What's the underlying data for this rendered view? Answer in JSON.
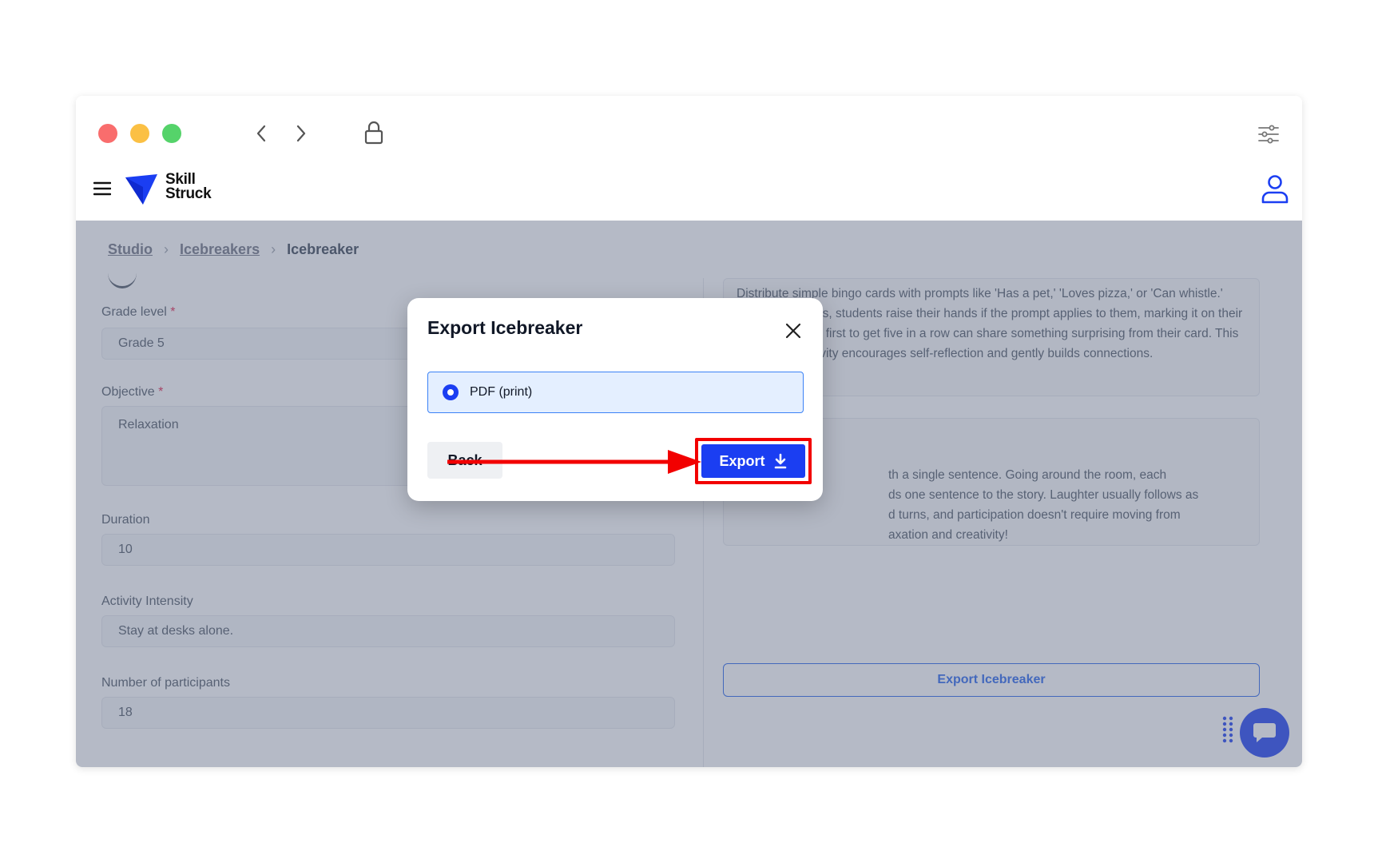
{
  "breadcrumb": {
    "items": [
      "Studio",
      "Icebreakers"
    ],
    "current": "Icebreaker",
    "separator": ">"
  },
  "brand": {
    "name_line1": "Skill",
    "name_line2": "Struck",
    "color": "#1b3ef2"
  },
  "form": {
    "grade_level": {
      "label": "Grade level",
      "required": "*",
      "value": "Grade 5"
    },
    "objective": {
      "label": "Objective",
      "required": "*",
      "value": "Relaxation"
    },
    "duration": {
      "label": "Duration",
      "value": "10"
    },
    "activity_intensity": {
      "label": "Activity Intensity",
      "value": "Stay at desks alone."
    },
    "participants": {
      "label": "Number of participants",
      "value": "18"
    }
  },
  "cards": {
    "first": "Distribute simple bingo cards with prompts like 'Has a pet,' 'Loves pizza,' or 'Can whistle.' From their desks, students raise their hands if the prompt applies to them, marking it on their bingo card. The first to get five in a row can share something surprising from their card. This low-energy activity encourages self-reflection and gently builds connections.",
    "second_line1": "th a single sentence. Going around the room, each",
    "second_line2": "ds one sentence to the story. Laughter usually follows as",
    "second_line3": "d turns, and participation doesn't require moving from",
    "second_line4": "axation and creativity!"
  },
  "export_outline_label": "Export Icebreaker",
  "modal": {
    "title": "Export Icebreaker",
    "option_label": "PDF (print)",
    "back_label": "Back",
    "export_label": "Export"
  },
  "colors": {
    "accent": "#1b3ef2",
    "highlight": "#f20000",
    "mac_red": "#f96d6d",
    "mac_yellow": "#fbc044",
    "mac_green": "#55d36a"
  },
  "icons": [
    "chevron-left-icon",
    "chevron-right-icon",
    "lock-icon",
    "sliders-icon",
    "hamburger-icon",
    "user-icon",
    "close-icon",
    "download-icon",
    "chat-icon",
    "grip-icon"
  ]
}
